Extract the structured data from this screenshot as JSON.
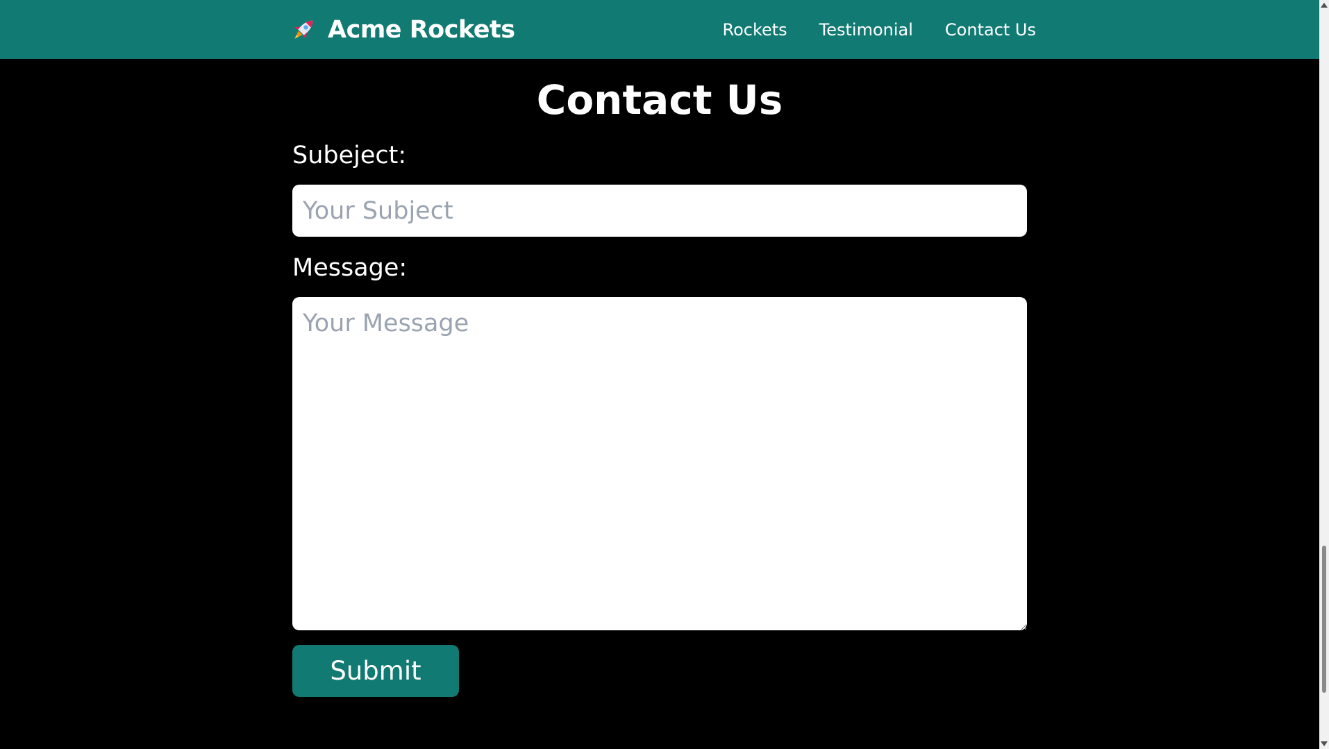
{
  "navbar": {
    "background_color": "#117a72",
    "brand": {
      "icon": "rocket-icon",
      "text": "Acme Rockets"
    },
    "links": [
      {
        "label": "Rockets"
      },
      {
        "label": "Testimonial"
      },
      {
        "label": "Contact Us"
      }
    ]
  },
  "main": {
    "title": "Contact Us",
    "subject": {
      "label": "Subeject:",
      "placeholder": "Your Subject",
      "value": ""
    },
    "message": {
      "label": "Message:",
      "placeholder": "Your Message",
      "value": ""
    },
    "submit_label": "Submit",
    "accent_color": "#117a72",
    "background_color": "#000000"
  }
}
